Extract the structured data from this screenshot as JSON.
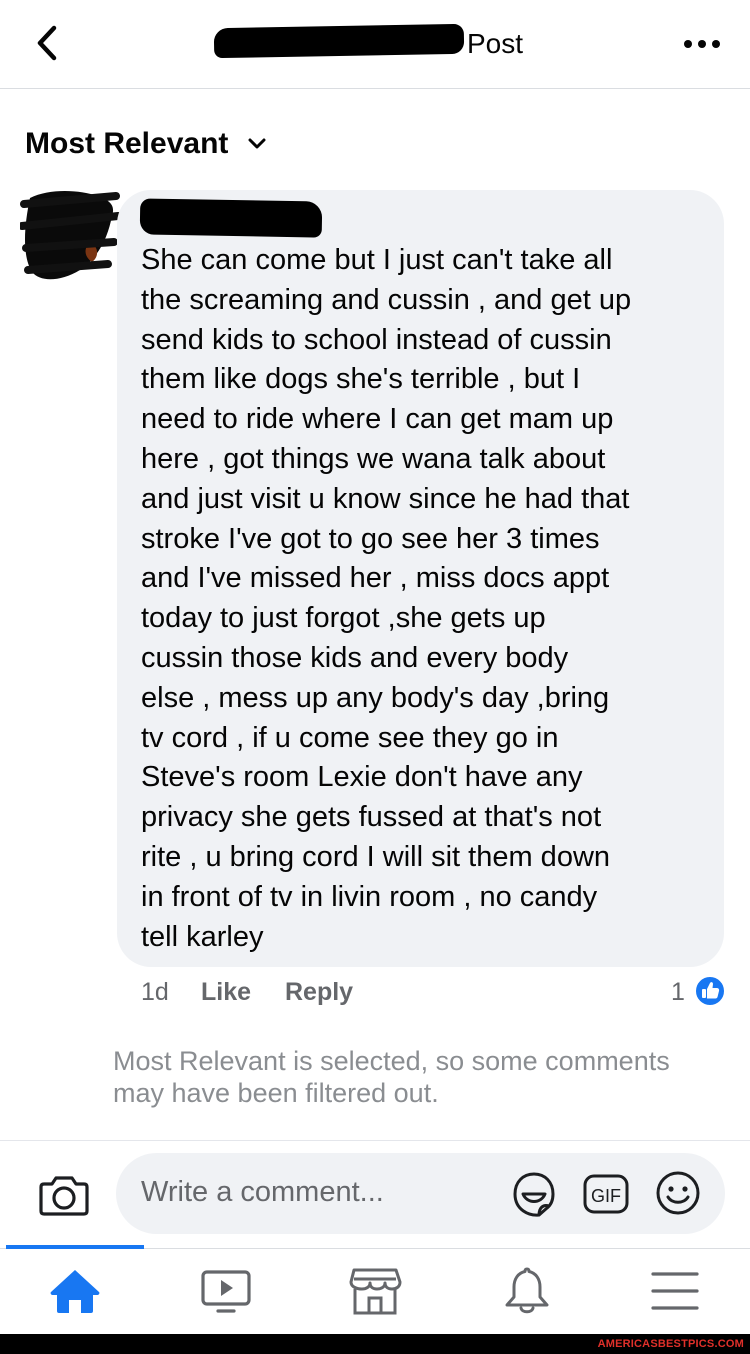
{
  "header": {
    "title": "Post"
  },
  "sort": {
    "label": "Most Relevant"
  },
  "comment": {
    "text": "She can come but I just can't take all\nthe screaming and cussin  , and get up\nsend kids to school instead of cussin\nthem like dogs she's terrible , but I\nneed to ride where I can get mam up\nhere , got things we wana talk about\nand just visit u know since he had that\nstroke I've got to go see her 3 times\nand I've missed her , miss docs appt\ntoday to just forgot ,she gets up\ncussin those kids and every body\nelse , mess up any body's  day ,bring\ntv cord , if u come see they go in\nSteve's room Lexie don't have any\nprivacy she gets fussed at that's not\nrite , u bring cord I will sit them down\nin front of tv in livin room , no candy\ntell karley",
    "time": "1d",
    "like_label": "Like",
    "reply_label": "Reply",
    "like_count": "1"
  },
  "filter_note": "Most Relevant is selected, so some comments may have been filtered out.",
  "composer": {
    "placeholder": "Write a comment..."
  },
  "gif_label": "GIF",
  "tabs": [
    "home-icon",
    "watch-icon",
    "marketplace-icon",
    "notifications-icon",
    "menu-icon"
  ],
  "colors": {
    "accent": "#1877f2",
    "bubble": "#f0f2f5",
    "secondary_text": "#65676b"
  },
  "watermark": "AMERICASBESTPICS.COM"
}
